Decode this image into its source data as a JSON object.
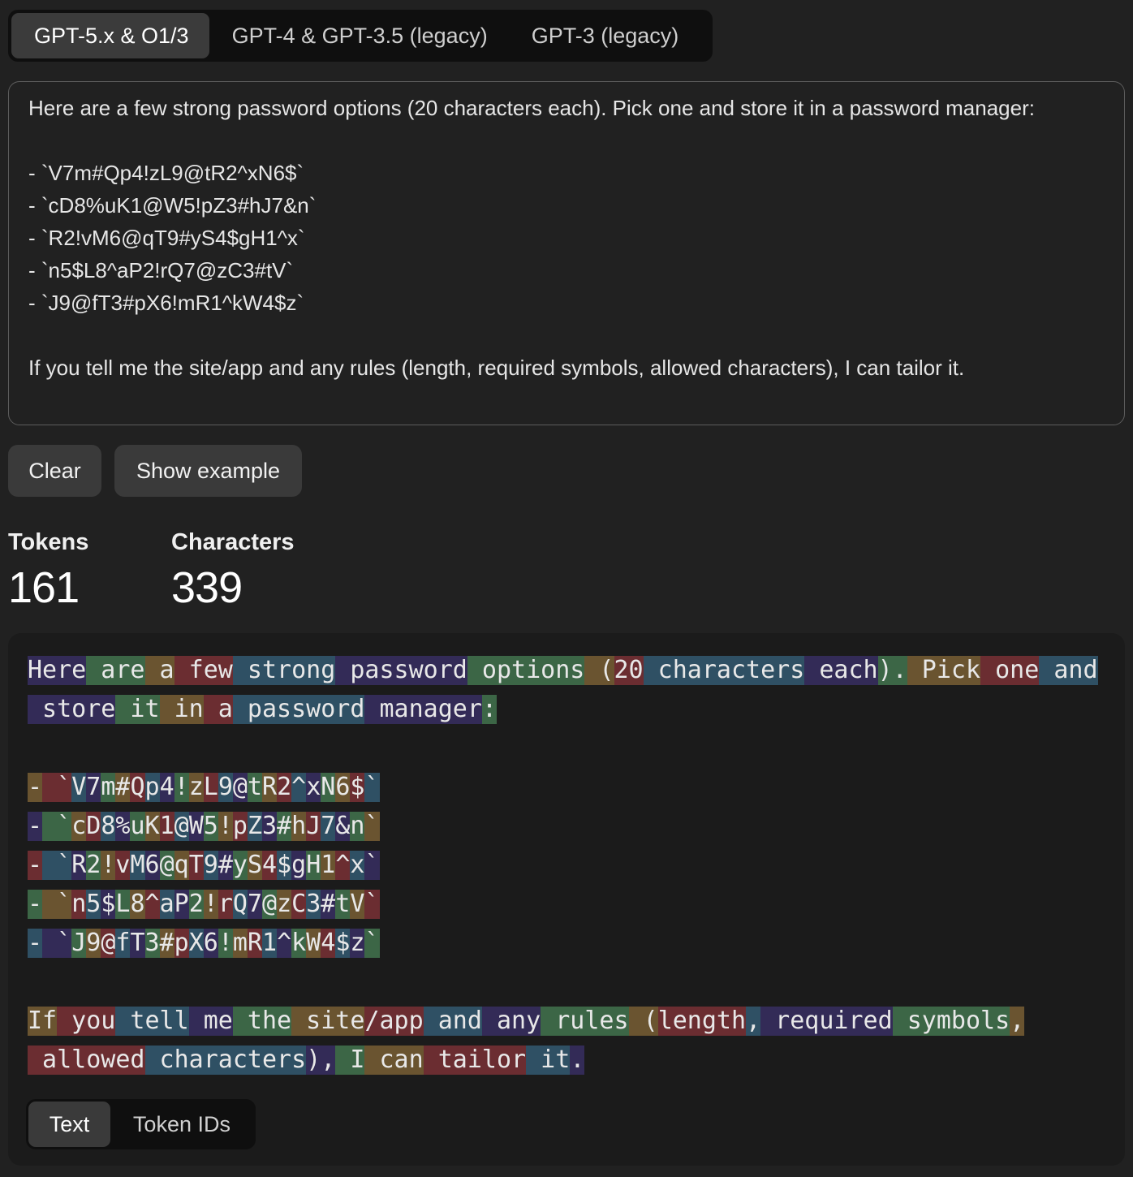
{
  "model_tabs": [
    {
      "label": "GPT-5.x & O1/3",
      "active": true
    },
    {
      "label": "GPT-4 & GPT-3.5 (legacy)",
      "active": false
    },
    {
      "label": "GPT-3 (legacy)",
      "active": false
    }
  ],
  "input_text": "Here are a few strong password options (20 characters each). Pick one and store it in a password manager:\n\n- `V7m#Qp4!zL9@tR2^xN6$`\n- `cD8%uK1@W5!pZ3#hJ7&n`\n- `R2!vM6@qT9#yS4$gH1^x`\n- `n5$L8^aP2!rQ7@zC3#tV`\n- `J9@fT3#pX6!mR1^kW4$z`\n\nIf you tell me the site/app and any rules (length, required symbols, allowed characters), I can tailor it.",
  "buttons": {
    "clear": "Clear",
    "show_example": "Show example"
  },
  "stats": {
    "tokens_label": "Tokens",
    "tokens_value": "161",
    "characters_label": "Characters",
    "characters_value": "339"
  },
  "token_lines": [
    [
      "Here",
      " are",
      " a",
      " few",
      " strong",
      " password",
      " options",
      " (",
      "20",
      " characters",
      " each",
      ").",
      " Pick",
      " one",
      " and"
    ],
    [
      " store",
      " it",
      " in",
      " a",
      " password",
      " manager",
      ":"
    ],
    [],
    [
      "-",
      " `",
      "V",
      "7",
      "m",
      "#",
      "Q",
      "p",
      "4",
      "!",
      "z",
      "L",
      "9",
      "@",
      "t",
      "R",
      "2",
      "^",
      "x",
      "N",
      "6",
      "$",
      "`"
    ],
    [
      "-",
      " `",
      "c",
      "D",
      "8",
      "%",
      "u",
      "K",
      "1",
      "@",
      "W",
      "5",
      "!",
      "p",
      "Z",
      "3",
      "#",
      "h",
      "J",
      "7",
      "&",
      "n",
      "`"
    ],
    [
      "-",
      " `",
      "R",
      "2",
      "!",
      "v",
      "M",
      "6",
      "@",
      "q",
      "T",
      "9",
      "#",
      "y",
      "S",
      "4",
      "$",
      "g",
      "H",
      "1",
      "^",
      "x",
      "`"
    ],
    [
      "-",
      " `",
      "n",
      "5",
      "$",
      "L",
      "8",
      "^",
      "a",
      "P",
      "2",
      "!",
      "r",
      "Q",
      "7",
      "@",
      "z",
      "C",
      "3",
      "#",
      "t",
      "V",
      "`"
    ],
    [
      "-",
      " `",
      "J",
      "9",
      "@",
      "f",
      "T",
      "3",
      "#",
      "p",
      "X",
      "6",
      "!",
      "m",
      "R",
      "1",
      "^",
      "k",
      "W",
      "4",
      "$",
      "z",
      "`"
    ],
    [],
    [
      "If",
      " you",
      " tell",
      " me",
      " the",
      " site",
      "/app",
      " and",
      " any",
      " rules",
      " (",
      "length",
      ",",
      " required",
      " symbols",
      ","
    ],
    [
      " allowed",
      " characters",
      "),",
      " I",
      " can",
      " tailor",
      " it",
      "."
    ]
  ],
  "token_colors": [
    "#332b57",
    "#3c6646",
    "#6a5430",
    "#6b2d31",
    "#2f5064"
  ],
  "view_toggle": [
    {
      "label": "Text",
      "active": true
    },
    {
      "label": "Token IDs",
      "active": false
    }
  ]
}
